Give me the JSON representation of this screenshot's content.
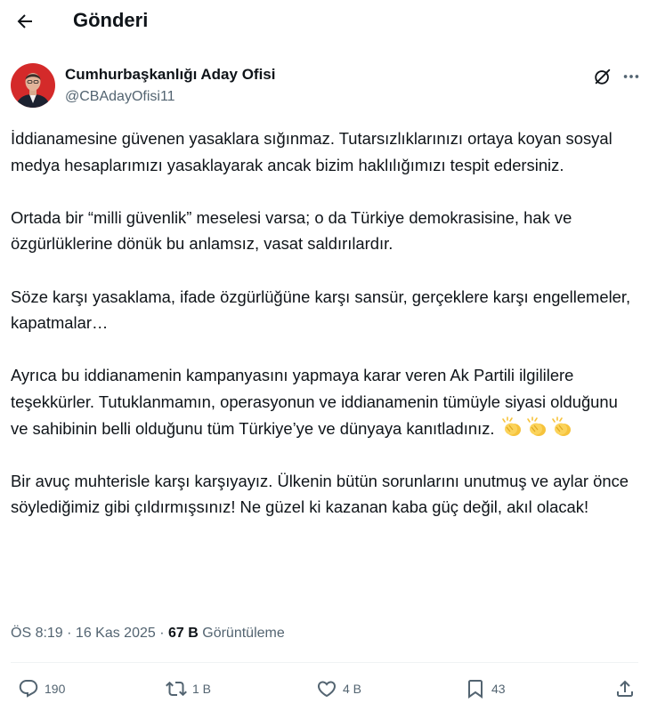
{
  "header": {
    "title": "Gönderi"
  },
  "author": {
    "name": "Cumhurbaşkanlığı Aday Ofisi",
    "handle": "@CBAdayOfisi11"
  },
  "tweet": {
    "paragraphs": [
      "İddianamesine güvenen yasaklara sığınmaz. Tutarsızlıklarınızı ortaya koyan sosyal medya hesaplarımızı yasaklayarak ancak bizim haklılığımızı tespit edersiniz.",
      "Ortada bir “milli güvenlik” meselesi varsa; o da Türkiye demokrasisine, hak ve özgürlüklerine dönük bu anlamsız, vasat saldırılardır.",
      "Söze karşı yasaklama, ifade özgürlüğüne karşı sansür, gerçeklere karşı engellemeler, kapatmalar…",
      "Ayrıca bu iddianamenin kampanyasını yapmaya karar veren Ak Partili ilgililere teşekkürler. Tutuklanmamın, operasyonun ve iddianamenin tümüyle siyasi olduğunu ve sahibinin belli olduğunu tüm Türkiye’ye ve dünyaya kanıtladınız.",
      "Bir avuç muhterisle karşı karşıyayız. Ülkenin bütün sorunlarını unutmuş ve aylar önce söylediğimiz gibi çıldırmışsınız! Ne güzel ki kazanan kaba güç değil, akıl olacak!"
    ],
    "emoji": "clapping-hands-x3"
  },
  "meta": {
    "time": "ÖS 8:19",
    "sep": " · ",
    "date": "16 Kas 2025",
    "views": "67 B",
    "views_label": "Görüntüleme"
  },
  "actions": {
    "replies": "190",
    "reposts": "1 B",
    "likes": "4 B",
    "bookmarks": "43"
  },
  "colors": {
    "text": "#0f1419",
    "secondary": "#536471",
    "divider": "#eff3f4",
    "clap": "#f6c33c"
  }
}
